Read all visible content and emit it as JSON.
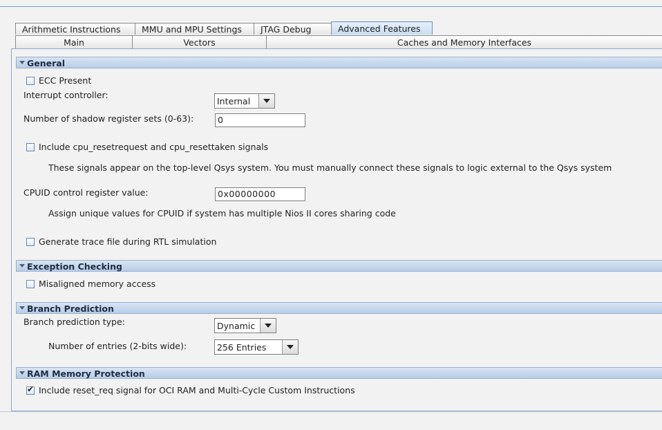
{
  "tabs_row1": [
    "Arithmetic Instructions",
    "MMU and MPU Settings",
    "JTAG Debug",
    "Advanced Features"
  ],
  "tabs_row2": [
    "Main",
    "Vectors",
    "Caches and Memory Interfaces"
  ],
  "active_tab": "Advanced Features",
  "general": {
    "title": "General",
    "ecc_present": "ECC Present",
    "interrupt_controller_label": "Interrupt controller:",
    "interrupt_controller_value": "Internal",
    "shadow_label": "Number of shadow register sets (0-63):",
    "shadow_value": "0",
    "reset_signals": "Include cpu_resetrequest and cpu_resettaken signals",
    "reset_note": "These signals appear on the top-level Qsys system. You must manually connect these signals to logic external to the Qsys system",
    "cpuid_label": "CPUID control register value:",
    "cpuid_value": "0x00000000",
    "cpuid_note": "Assign unique values for CPUID if system has multiple Nios II cores sharing code",
    "trace_file": "Generate trace file during RTL simulation"
  },
  "exception": {
    "title": "Exception Checking",
    "misaligned": "Misaligned memory access"
  },
  "branch": {
    "title": "Branch Prediction",
    "type_label": "Branch prediction type:",
    "type_value": "Dynamic",
    "entries_label": "Number of entries (2-bits wide):",
    "entries_value": "256 Entries"
  },
  "ram": {
    "title": "RAM Memory Protection",
    "reset_req": "Include reset_req signal for OCI RAM and Multi-Cycle Custom Instructions",
    "reset_req_checked": true
  },
  "colors": {
    "section_header": "#c7d8ec",
    "active_tab": "#d5e4f6",
    "panel_border": "#8ea6c8"
  }
}
